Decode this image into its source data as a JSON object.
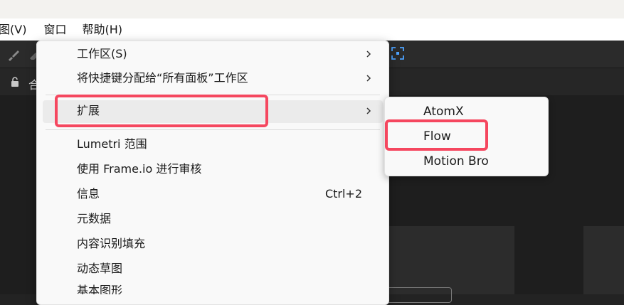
{
  "menubar": {
    "items": [
      {
        "label": "图(V)"
      },
      {
        "label": "窗口"
      },
      {
        "label": "帮助(H)"
      }
    ]
  },
  "panel": {
    "partial_label": "合"
  },
  "window_menu": {
    "items": [
      {
        "label": "工作区(S)",
        "has_submenu": true
      },
      {
        "label": "将快捷键分配给“所有面板”工作区",
        "has_submenu": true
      },
      {
        "label": "扩展",
        "has_submenu": true,
        "highlighted": true
      },
      {
        "label": "Lumetri 范围"
      },
      {
        "label": "使用 Frame.io 进行审核"
      },
      {
        "label": "信息",
        "shortcut": "Ctrl+2"
      },
      {
        "label": "元数据"
      },
      {
        "label": "内容识别填充"
      },
      {
        "label": "动态草图"
      },
      {
        "label": "基本图形"
      }
    ]
  },
  "extensions_submenu": {
    "items": [
      {
        "label": "AtomX"
      },
      {
        "label": "Flow"
      },
      {
        "label": "Motion Bro"
      }
    ]
  },
  "colors": {
    "annotation": "#f5475f",
    "menu_bg": "#f9f9f9",
    "app_bg": "#232323"
  }
}
